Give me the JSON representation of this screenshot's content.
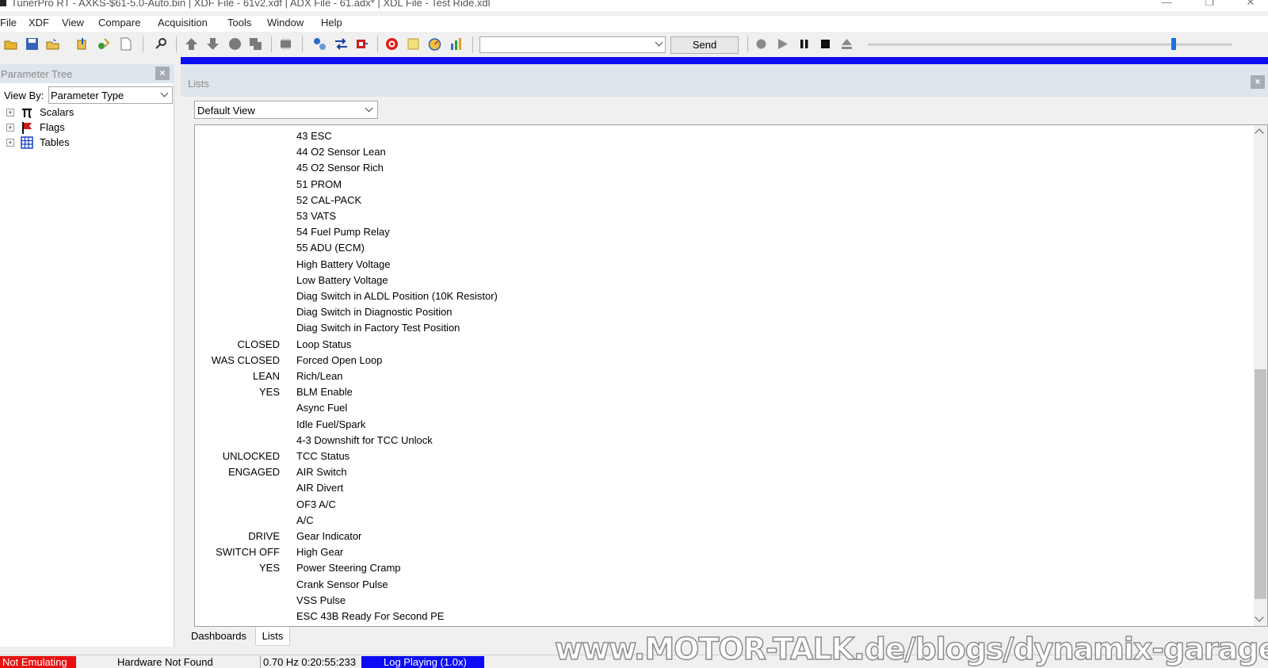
{
  "window": {
    "title": "TunerPro RT - AXKS-$61-5.0-Auto.bin | XDF File - 61v2.xdf | ADX File - 61.adx* | XDL File - Test Ride.xdl"
  },
  "menu": [
    "File",
    "XDF",
    "View",
    "Compare",
    "Acquisition",
    "Tools",
    "Window",
    "Help"
  ],
  "toolbar": {
    "send_label": "Send",
    "combo_value": "",
    "playback_slider_fraction": 0.84
  },
  "parameter_tree": {
    "title": "Parameter Tree",
    "view_by_label": "View By:",
    "view_by_value": "Parameter Type",
    "items": [
      {
        "label": "Scalars",
        "icon": "pi-icon"
      },
      {
        "label": "Flags",
        "icon": "flag-icon"
      },
      {
        "label": "Tables",
        "icon": "table-icon"
      }
    ]
  },
  "lists": {
    "title": "Lists",
    "view_value": "Default View",
    "rows": [
      {
        "value": "",
        "name": "43 ESC"
      },
      {
        "value": "",
        "name": "44 O2 Sensor Lean"
      },
      {
        "value": "",
        "name": "45 O2 Sensor Rich"
      },
      {
        "value": "",
        "name": "51 PROM"
      },
      {
        "value": "",
        "name": "52 CAL-PACK"
      },
      {
        "value": "",
        "name": "53 VATS"
      },
      {
        "value": "",
        "name": "54 Fuel Pump Relay"
      },
      {
        "value": "",
        "name": "55 ADU (ECM)"
      },
      {
        "value": "",
        "name": "High Battery Voltage"
      },
      {
        "value": "",
        "name": "Low Battery Voltage"
      },
      {
        "value": "",
        "name": "Diag Switch in ALDL Position (10K Resistor)"
      },
      {
        "value": "",
        "name": "Diag Switch in Diagnostic Position"
      },
      {
        "value": "",
        "name": "Diag Switch in Factory Test Position"
      },
      {
        "value": "CLOSED",
        "name": "Loop Status"
      },
      {
        "value": "WAS CLOSED",
        "name": "Forced Open Loop"
      },
      {
        "value": "LEAN",
        "name": "Rich/Lean"
      },
      {
        "value": "YES",
        "name": "BLM Enable"
      },
      {
        "value": "",
        "name": "Async Fuel"
      },
      {
        "value": "",
        "name": "Idle Fuel/Spark"
      },
      {
        "value": "",
        "name": "4-3 Downshift for TCC Unlock"
      },
      {
        "value": "UNLOCKED",
        "name": "TCC Status"
      },
      {
        "value": "ENGAGED",
        "name": "AIR Switch"
      },
      {
        "value": "",
        "name": "AIR Divert"
      },
      {
        "value": "",
        "name": "OF3 A/C"
      },
      {
        "value": "",
        "name": "A/C"
      },
      {
        "value": "DRIVE",
        "name": "Gear Indicator"
      },
      {
        "value": "SWITCH OFF",
        "name": "High Gear"
      },
      {
        "value": "YES",
        "name": "Power Steering Cramp"
      },
      {
        "value": "",
        "name": "Crank Sensor Pulse"
      },
      {
        "value": "",
        "name": "VSS Pulse"
      },
      {
        "value": "",
        "name": "ESC 43B Ready For Second PE"
      }
    ]
  },
  "tabs": [
    "Dashboards",
    "Lists"
  ],
  "status": {
    "emulation": "Not Emulating",
    "hardware": "Hardware Not Found",
    "rate_time": "0.70 Hz  0:20:55:233",
    "log": "Log Playing (1.0x)"
  },
  "watermark": "www.MOTOR-TALK.de/blogs/dynamix-garage/",
  "colors": {
    "emulation_bg": "#e81010",
    "log_bg": "#0b0bf5",
    "accent_bar": "#0b0bf5"
  }
}
